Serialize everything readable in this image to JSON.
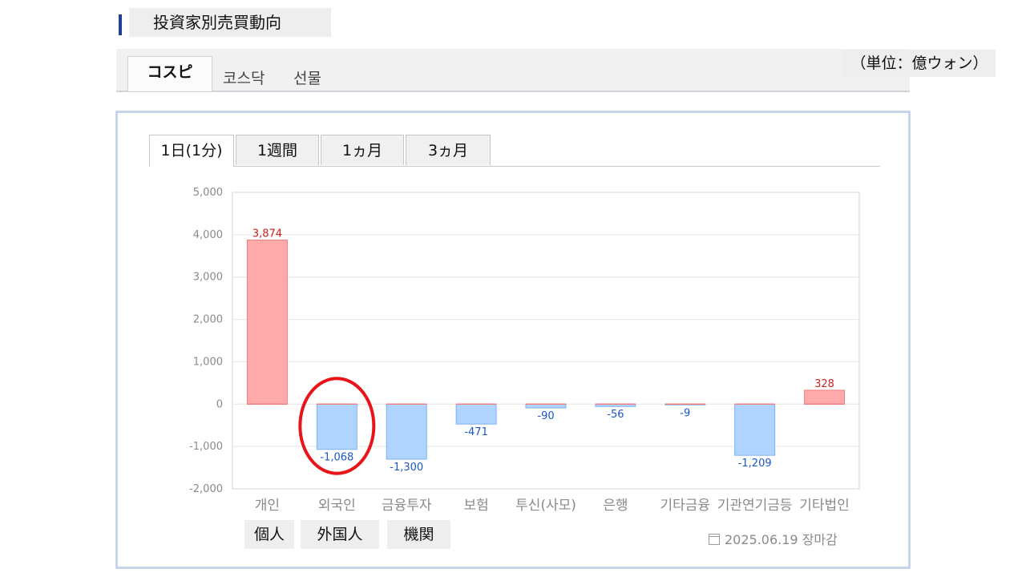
{
  "header": {
    "title": "投資家別売買動向"
  },
  "market_tabs": [
    {
      "label": "コスピ",
      "active": true
    },
    {
      "label": "코스닥",
      "active": false
    },
    {
      "label": "선물",
      "active": false
    }
  ],
  "unit": "（単位：億ウォン）",
  "period_tabs": [
    {
      "label": "1日(1分)",
      "active": true
    },
    {
      "label": "1週間",
      "active": false
    },
    {
      "label": "1ヵ月",
      "active": false
    },
    {
      "label": "3ヵ月",
      "active": false
    }
  ],
  "chart_data": {
    "type": "bar",
    "categories": [
      "개인",
      "외국인",
      "금융투자",
      "보험",
      "투신(사모)",
      "은행",
      "기타금융",
      "기관연기금등",
      "기타법인"
    ],
    "values": [
      3874,
      -1068,
      -1300,
      -471,
      -90,
      -56,
      -9,
      -1209,
      328
    ],
    "data_labels": [
      "3,874",
      "-1,068",
      "-1,300",
      "-471",
      "-90",
      "-56",
      "-9",
      "-1,209",
      "328"
    ],
    "ylim": [
      -2000,
      5000
    ],
    "yticks": [
      5000,
      4000,
      3000,
      2000,
      1000,
      0,
      -1000,
      -2000
    ],
    "ytick_labels": [
      "5,000",
      "4,000",
      "3,000",
      "2,000",
      "1,000",
      "0",
      "-1,000",
      "-2,000"
    ],
    "grid": true,
    "colors": {
      "positive": "#ffaaaa",
      "negative": "#aed4ff",
      "positive_label": "#d22020",
      "negative_label": "#1a56c8",
      "highlight": "#e8141a"
    },
    "highlight_index": 1,
    "title": "",
    "xlabel": "",
    "ylabel": ""
  },
  "category_annotations": [
    {
      "label": "個人"
    },
    {
      "label": "外国人"
    },
    {
      "label": "機関"
    }
  ],
  "footer": {
    "date": "2025.06.19 장마감",
    "icon": "calendar-icon"
  }
}
